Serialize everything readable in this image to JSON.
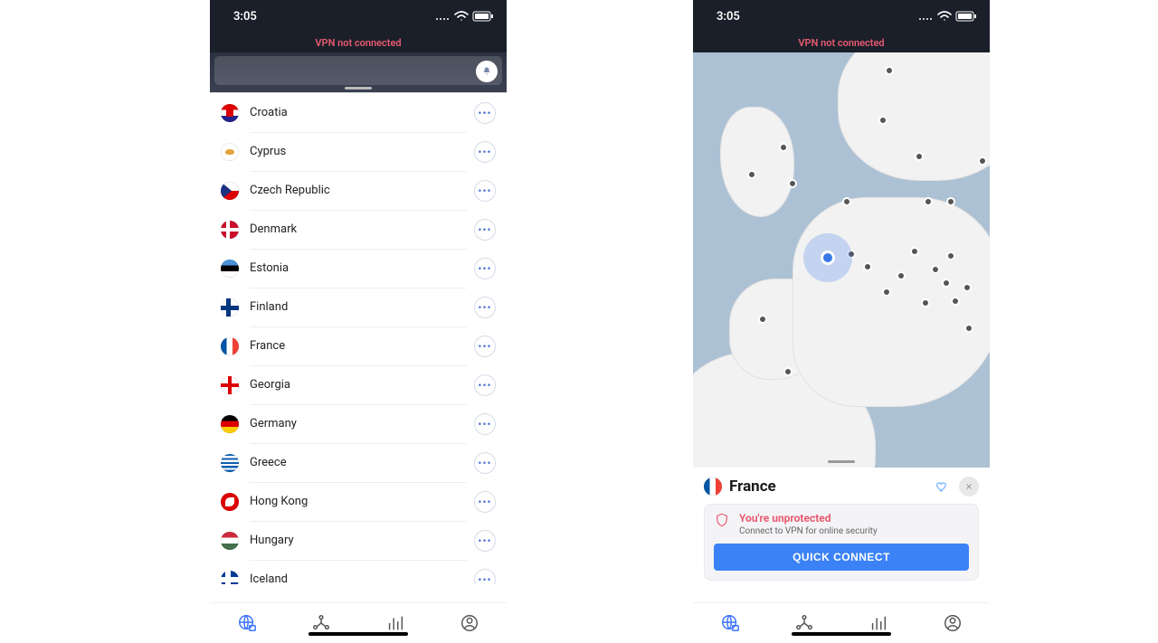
{
  "status": {
    "time": "3:05"
  },
  "banner": "VPN not connected",
  "countries": [
    {
      "name": "Croatia",
      "flag": "croatia"
    },
    {
      "name": "Cyprus",
      "flag": "cyprus"
    },
    {
      "name": "Czech Republic",
      "flag": "czech"
    },
    {
      "name": "Denmark",
      "flag": "denmark"
    },
    {
      "name": "Estonia",
      "flag": "estonia"
    },
    {
      "name": "Finland",
      "flag": "finland"
    },
    {
      "name": "France",
      "flag": "france"
    },
    {
      "name": "Georgia",
      "flag": "georgia"
    },
    {
      "name": "Germany",
      "flag": "germany"
    },
    {
      "name": "Greece",
      "flag": "greece"
    },
    {
      "name": "Hong Kong",
      "flag": "hongkong"
    },
    {
      "name": "Hungary",
      "flag": "hungary"
    },
    {
      "name": "Iceland",
      "flag": "iceland"
    }
  ],
  "selected": {
    "name": "France",
    "flag": "france"
  },
  "warn": {
    "title": "You're unprotected",
    "subtitle": "Connect to VPN for online security"
  },
  "connect_label": "QUICK CONNECT"
}
